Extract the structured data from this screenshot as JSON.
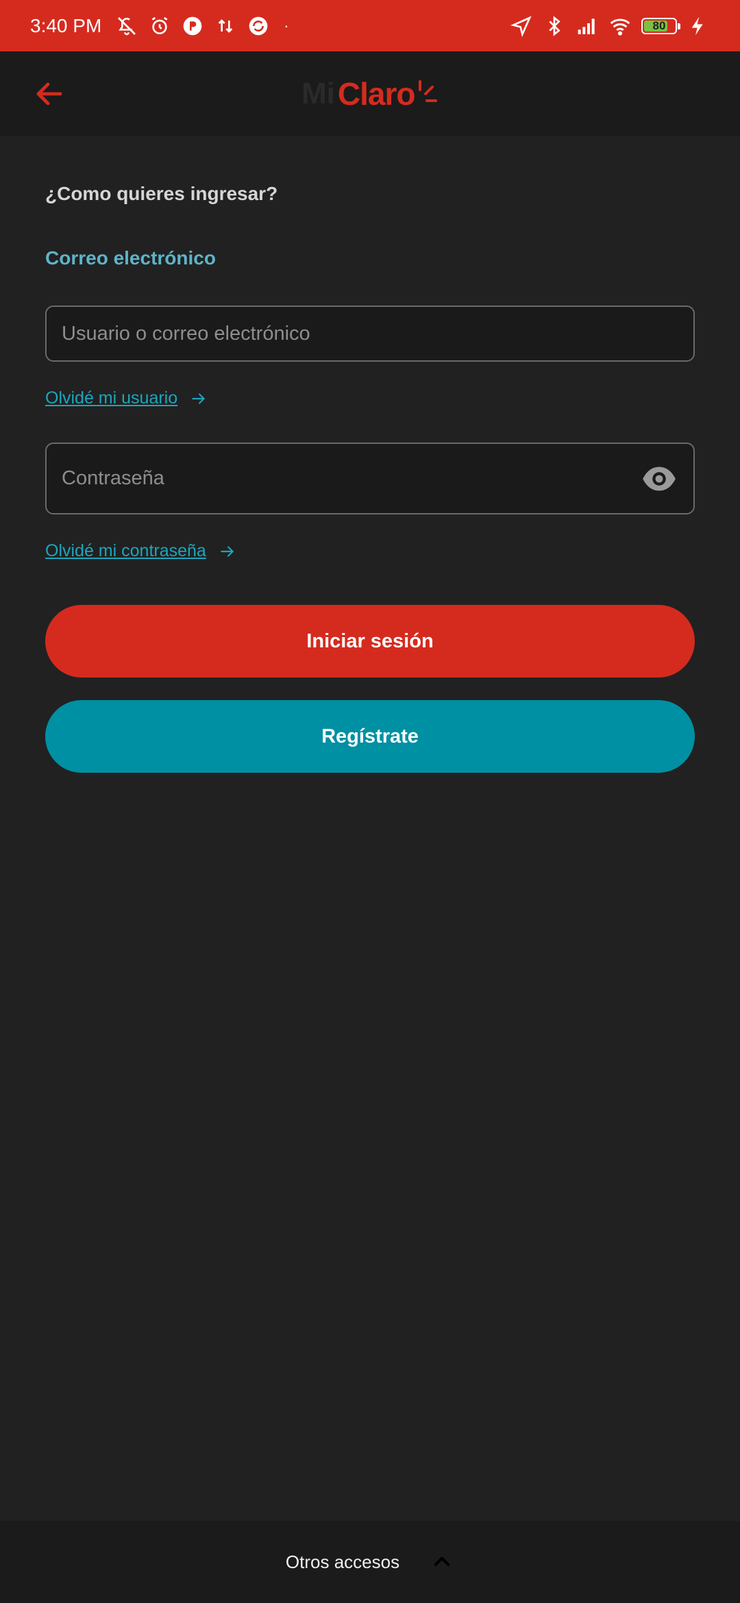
{
  "status_bar": {
    "time": "3:40 PM",
    "battery_level": "80",
    "battery_fraction": 0.8,
    "left_icons": [
      "mute-notifications-icon",
      "alarm-icon",
      "app-badge-icon",
      "data-transfer-icon",
      "sync-icon"
    ],
    "right_icons": [
      "location-icon",
      "bluetooth-icon",
      "signal-icon",
      "wifi-icon",
      "battery-icon",
      "charging-icon"
    ]
  },
  "header": {
    "brand_prefix": "Mi",
    "brand_name": "Claro",
    "back_icon": "arrow-left-icon"
  },
  "login": {
    "prompt": "¿Como quieres ingresar?",
    "method_label": "Correo electrónico",
    "username_placeholder": "Usuario o correo electrónico",
    "username_value": "",
    "forgot_user": "Olvidé mi usuario",
    "password_placeholder": "Contraseña",
    "password_value": "",
    "forgot_password": "Olvidé mi contraseña",
    "login_button": "Iniciar sesión",
    "register_button": "Regístrate"
  },
  "bottom": {
    "label": "Otros accesos",
    "icon": "chevron-up-icon"
  },
  "colors": {
    "brand_red": "#d52b1e",
    "teal": "#0090a3",
    "link_teal": "#1ba6bd",
    "label_blue": "#5fb3c8",
    "background": "#212121"
  }
}
